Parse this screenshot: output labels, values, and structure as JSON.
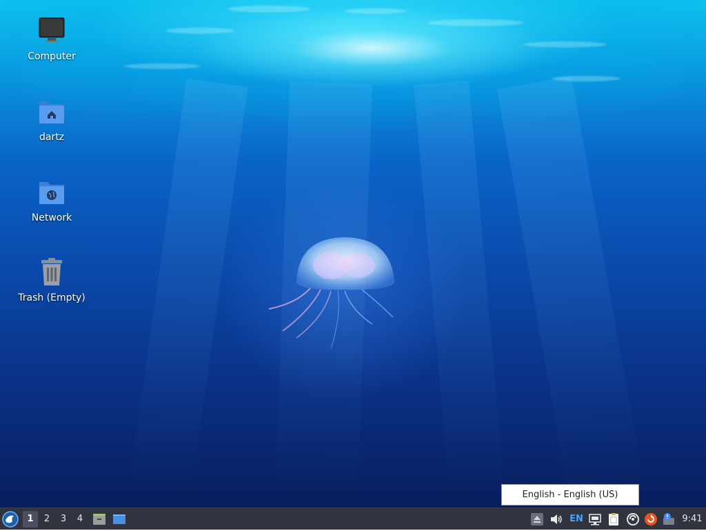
{
  "desktop": {
    "wallpaper": "underwater-jellyfish",
    "icons": [
      {
        "label": "Computer",
        "icon": "computer-icon"
      },
      {
        "label": "dartz",
        "icon": "home-folder-icon"
      },
      {
        "label": "Network",
        "icon": "network-folder-icon"
      },
      {
        "label": "Trash (Empty)",
        "icon": "trash-icon"
      }
    ]
  },
  "tooltip": {
    "text": "English - English (US)"
  },
  "panel": {
    "menu_icon": "lubuntu-menu-icon",
    "workspaces": [
      "1",
      "2",
      "3",
      "4"
    ],
    "active_workspace": "1",
    "quicklaunch": [
      "file-manager-icon",
      "show-desktop-icon"
    ],
    "tray": {
      "eject_icon": "eject-icon",
      "volume_icon": "volume-icon",
      "keyboard_layout": "EN",
      "network_icon": "network-wired-icon",
      "clipboard_icon": "clipboard-icon",
      "update_icon": "update-notifier-icon",
      "software_updater_icon": "software-updater-icon",
      "notification_icon": "notification-icon"
    },
    "clock": "9:41"
  },
  "colors": {
    "panel_bg": "#2f343f",
    "keyboard_accent": "#4aa3ff",
    "water_top": "#10c2ec",
    "water_bottom": "#081e5c"
  }
}
